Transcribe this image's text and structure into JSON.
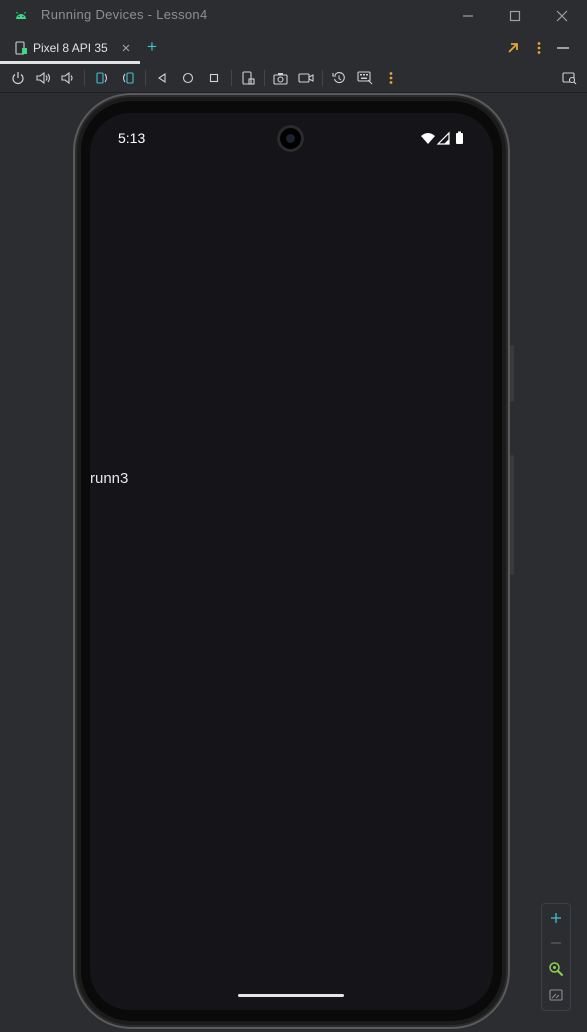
{
  "window": {
    "title": "Running Devices - Lesson4",
    "controls": [
      "minimize-icon",
      "maximize-icon",
      "close-icon"
    ]
  },
  "tabs": [
    {
      "label": "Pixel 8 API 35",
      "icon": "device-mirror-icon",
      "active": true
    }
  ],
  "tab_actions": {
    "add": "+"
  },
  "toolbar": {
    "icons": [
      "power-icon",
      "volume-up-icon",
      "volume-down-icon",
      "rotate-left-icon",
      "rotate-right-icon",
      "back-icon",
      "home-icon",
      "overview-icon",
      "device-frame-icon",
      "screenshot-icon",
      "screen-record-icon",
      "reset-icon",
      "keyboard-icon",
      "more-icon",
      "device-explorer-icon"
    ]
  },
  "device": {
    "status_bar": {
      "time": "5:13"
    },
    "app_text": "runn3"
  },
  "colors": {
    "background": "#2b2d30",
    "screen": "#151419",
    "accent": "#3ec1d3",
    "badge": "#e9a33a",
    "android_green": "#3ddc84"
  }
}
